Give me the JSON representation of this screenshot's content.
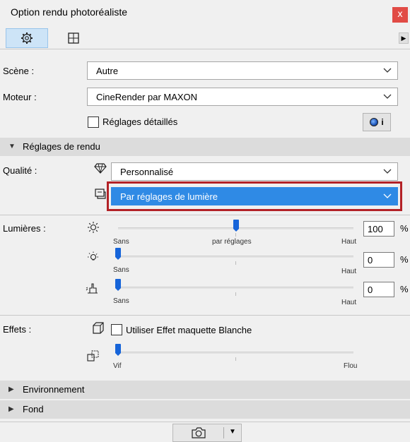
{
  "window": {
    "title": "Option rendu photoréaliste",
    "close_glyph": "x"
  },
  "tabs": [
    {
      "icon": "gear-icon",
      "active": true
    },
    {
      "icon": "frame-icon",
      "active": false
    }
  ],
  "tab_scroll_glyph": "▶",
  "scene": {
    "label": "Scène :",
    "value": "Autre"
  },
  "engine": {
    "label": "Moteur :",
    "value": "CineRender par MAXON"
  },
  "detailed_settings": {
    "label": "Réglages détaillés",
    "checked": false,
    "info_glyph": "i"
  },
  "render_section": {
    "label": "Réglages de rendu",
    "expanded": true
  },
  "quality": {
    "label": "Qualité :",
    "value": "Personnalisé"
  },
  "lighting_mode": {
    "value": "Par réglages de lumière",
    "highlighted": true
  },
  "lights": {
    "label": "Lumières :",
    "sliders": [
      {
        "icon": "sun-icon",
        "value": "100",
        "unit": "%",
        "min_label": "Sans",
        "mid_label": "par réglages",
        "max_label": "Haut",
        "level": 0.5
      },
      {
        "icon": "lightbulb-icon",
        "value": "0",
        "unit": "%",
        "min_label": "Sans",
        "max_label": "Haut",
        "level": 0.0
      },
      {
        "icon": "hand-light-icon",
        "value": "0",
        "unit": "%",
        "min_label": "Sans",
        "max_label": "Haut",
        "level": 0.0
      }
    ]
  },
  "effects": {
    "label": "Effets :",
    "white_model": {
      "label": "Utiliser Effet maquette Blanche",
      "checked": false
    },
    "blur_slider": {
      "min_label": "Vif",
      "max_label": "Flou",
      "level": 0.0
    }
  },
  "environment_section": {
    "label": "Environnement",
    "expanded": false
  },
  "background_section": {
    "label": "Fond",
    "expanded": false
  },
  "colors": {
    "accent": "#2f8ae5",
    "highlight_frame": "#b32227",
    "close": "#e14b45",
    "thumb": "#1664d9"
  }
}
